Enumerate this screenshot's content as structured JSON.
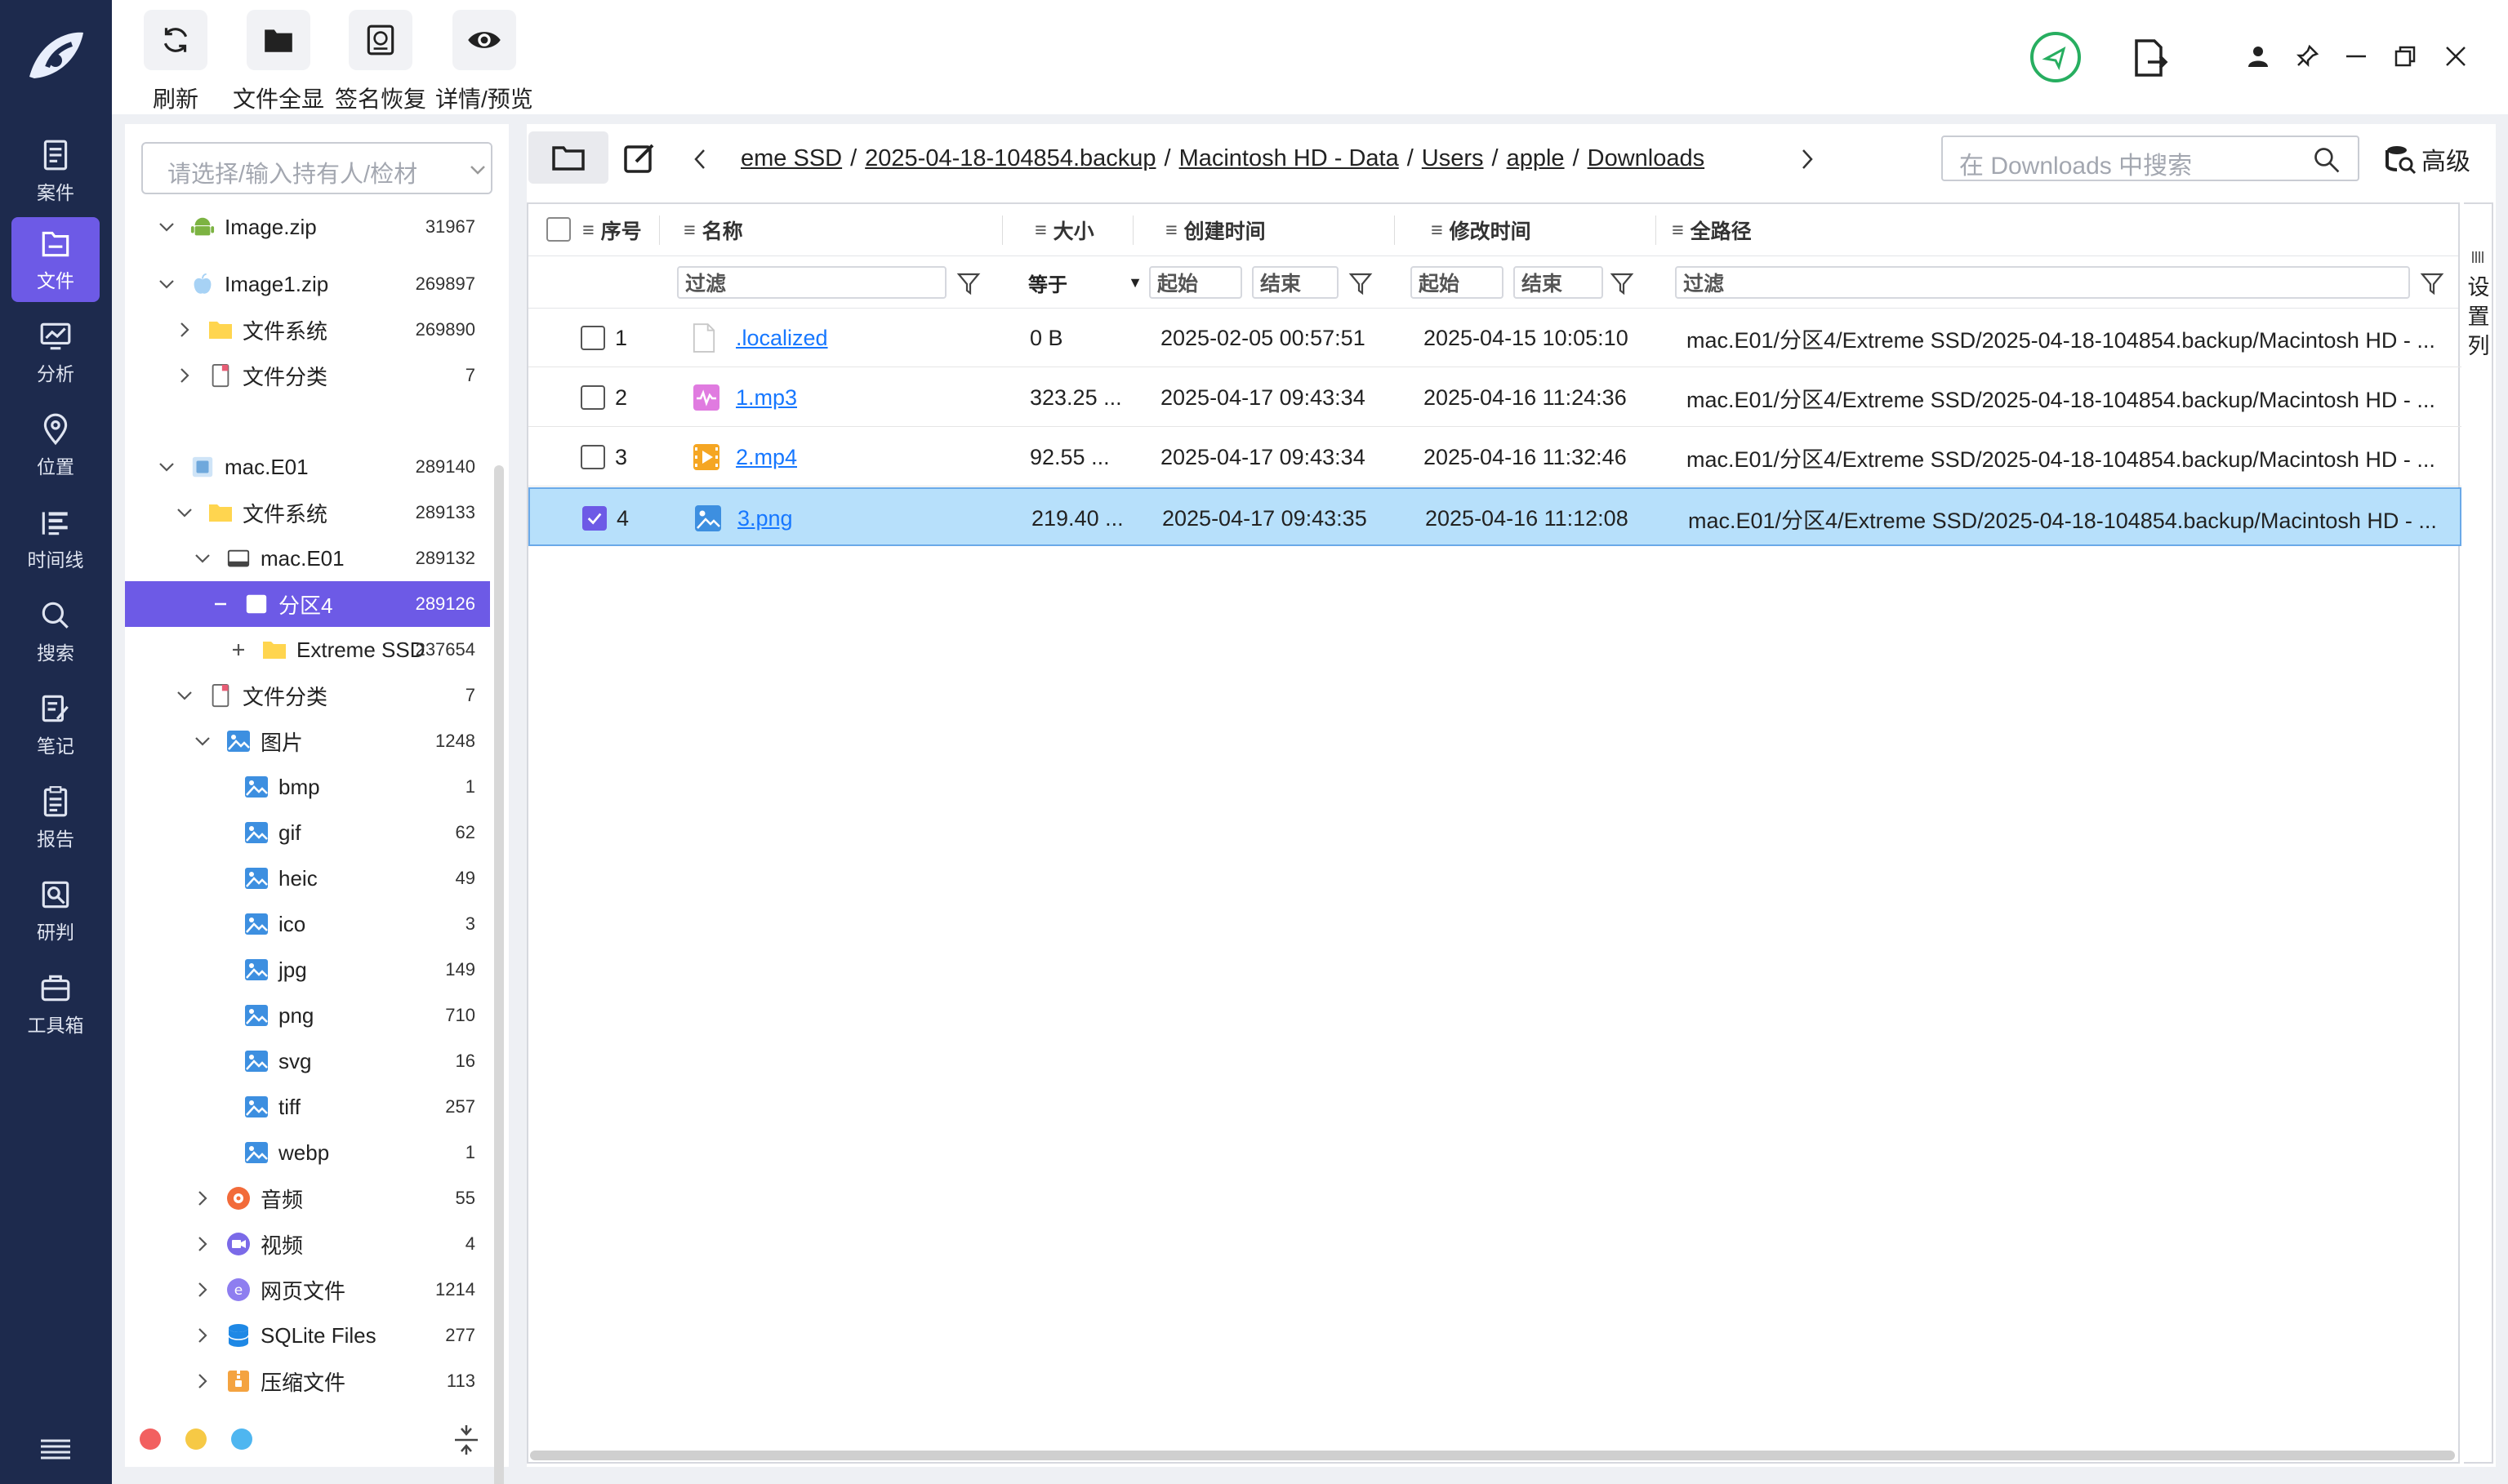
{
  "nav": {
    "items": [
      {
        "label": "案件",
        "icon": "case-icon"
      },
      {
        "label": "文件",
        "icon": "file-icon",
        "active": true
      },
      {
        "label": "分析",
        "icon": "analysis-icon"
      },
      {
        "label": "位置",
        "icon": "location-icon"
      },
      {
        "label": "时间线",
        "icon": "timeline-icon"
      },
      {
        "label": "搜索",
        "icon": "search-icon"
      },
      {
        "label": "笔记",
        "icon": "note-icon"
      },
      {
        "label": "报告",
        "icon": "report-icon"
      },
      {
        "label": "研判",
        "icon": "judge-icon"
      },
      {
        "label": "工具箱",
        "icon": "toolbox-icon"
      }
    ]
  },
  "toolbar": {
    "refresh": "刷新",
    "show_all_files": "文件全显",
    "signature_recover": "签名恢复",
    "detail_preview": "详情/预览"
  },
  "tree": {
    "owner_placeholder": "请选择/输入持有人/检材",
    "nodes": [
      {
        "label": "Image.zip",
        "count": "31967",
        "icon": "android-icon"
      },
      {
        "label": "Image1.zip",
        "count": "269897",
        "icon": "apple-icon"
      },
      {
        "label": "文件系统",
        "count": "269890",
        "icon": "folder-icon"
      },
      {
        "label": "文件分类",
        "count": "7",
        "icon": "file-category-icon"
      },
      {
        "label": "mac.E01",
        "count": "289140",
        "icon": "mac-icon"
      },
      {
        "label": "文件系统",
        "count": "289133",
        "icon": "folder-icon"
      },
      {
        "label": "mac.E01",
        "count": "289132",
        "icon": "disk-icon"
      },
      {
        "label": "分区4",
        "count": "289126",
        "icon": "partition-icon"
      },
      {
        "label": "Extreme SSD",
        "count": "237654",
        "icon": "folder-icon"
      },
      {
        "label": "文件分类",
        "count": "7",
        "icon": "file-category-icon"
      },
      {
        "label": "图片",
        "count": "1248",
        "icon": "image-icon"
      },
      {
        "label": "bmp",
        "count": "1",
        "icon": "image-icon"
      },
      {
        "label": "gif",
        "count": "62",
        "icon": "image-icon"
      },
      {
        "label": "heic",
        "count": "49",
        "icon": "image-icon"
      },
      {
        "label": "ico",
        "count": "3",
        "icon": "image-icon"
      },
      {
        "label": "jpg",
        "count": "149",
        "icon": "image-icon"
      },
      {
        "label": "png",
        "count": "710",
        "icon": "image-icon"
      },
      {
        "label": "svg",
        "count": "16",
        "icon": "image-icon"
      },
      {
        "label": "tiff",
        "count": "257",
        "icon": "image-icon"
      },
      {
        "label": "webp",
        "count": "1",
        "icon": "image-icon"
      },
      {
        "label": "音频",
        "count": "55",
        "icon": "audio-icon"
      },
      {
        "label": "视频",
        "count": "4",
        "icon": "video-icon"
      },
      {
        "label": "网页文件",
        "count": "1214",
        "icon": "web-icon"
      },
      {
        "label": "SQLite Files",
        "count": "277",
        "icon": "database-icon"
      },
      {
        "label": "压缩文件",
        "count": "113",
        "icon": "archive-icon"
      }
    ]
  },
  "path": {
    "segments": [
      "eme SSD",
      "2025-04-18-104854.backup",
      "Macintosh HD - Data",
      "Users",
      "apple",
      "Downloads"
    ],
    "separator": "/",
    "search_placeholder": "在 Downloads 中搜索",
    "advanced": "高级"
  },
  "grid": {
    "headers": {
      "index": "序号",
      "name": "名称",
      "size": "大小",
      "created": "创建时间",
      "modified": "修改时间",
      "fullpath": "全路径"
    },
    "filters": {
      "filter": "过滤",
      "equals": "等于",
      "start": "起始",
      "end": "结束"
    },
    "rows": [
      {
        "index": "1",
        "name": ".localized",
        "size": "0 B",
        "created": "2025-02-05 00:57:51",
        "modified": "2025-04-15 10:05:10",
        "fullpath": "mac.E01/分区4/Extreme SSD/2025-04-18-104854.backup/Macintosh HD - ...",
        "icon": "blank-file-icon",
        "checked": false
      },
      {
        "index": "2",
        "name": "1.mp3",
        "size": "323.25 ...",
        "created": "2025-04-17 09:43:34",
        "modified": "2025-04-16 11:24:36",
        "fullpath": "mac.E01/分区4/Extreme SSD/2025-04-18-104854.backup/Macintosh HD - ...",
        "icon": "audio-file-icon",
        "checked": false
      },
      {
        "index": "3",
        "name": "2.mp4",
        "size": "92.55 ...",
        "created": "2025-04-17 09:43:34",
        "modified": "2025-04-16 11:32:46",
        "fullpath": "mac.E01/分区4/Extreme SSD/2025-04-18-104854.backup/Macintosh HD - ...",
        "icon": "video-file-icon",
        "checked": false
      },
      {
        "index": "4",
        "name": "3.png",
        "size": "219.40 ...",
        "created": "2025-04-17 09:43:35",
        "modified": "2025-04-16 11:12:08",
        "fullpath": "mac.E01/分区4/Extreme SSD/2025-04-18-104854.backup/Macintosh HD - ...",
        "icon": "image-file-icon",
        "checked": true
      }
    ]
  },
  "column_settings": [
    "设",
    "置",
    "列"
  ],
  "colors": {
    "accent": "#6d5ae6",
    "nav_bg": "#1d2a4d",
    "link": "#1677ff",
    "selected_row": "#b7e0fb"
  }
}
